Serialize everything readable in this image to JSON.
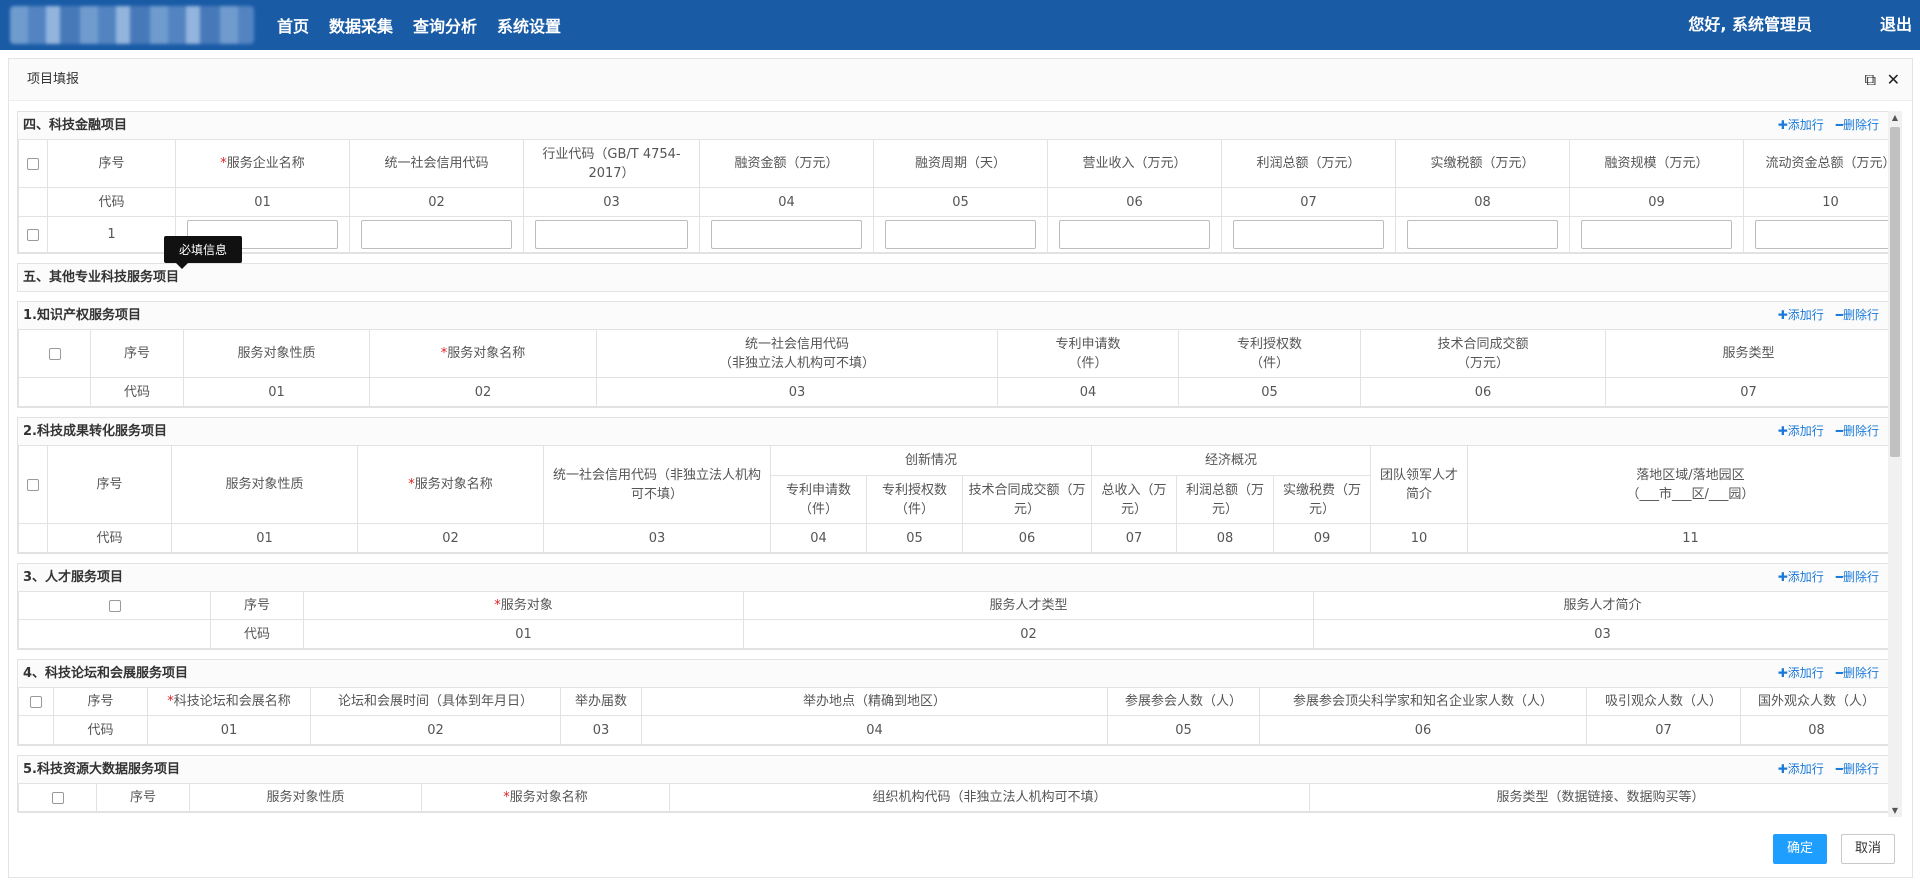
{
  "nav": {
    "items": [
      "首页",
      "数据采集",
      "查询分析",
      "系统设置"
    ],
    "greeting": "您好, 系统管理员",
    "logout": "退出"
  },
  "dialog": {
    "title": "项目填报",
    "confirm": "确定",
    "cancel": "取消",
    "tooltip": "必填信息"
  },
  "ops": {
    "add": "✚添加行",
    "del": "━删除行"
  },
  "s4": {
    "title": "四、科技金融项目",
    "headers": [
      "序号",
      "服务企业名称",
      "统一社会信用代码",
      "行业代码（GB/T 4754-2017）",
      "融资金额（万元）",
      "融资周期（天）",
      "营业收入（万元）",
      "利润总额（万元）",
      "实缴税额（万元）",
      "融资规模（万元）",
      "流动资金总额（万元）"
    ],
    "codes": [
      "代码",
      "01",
      "02",
      "03",
      "04",
      "05",
      "06",
      "07",
      "08",
      "09",
      "10"
    ],
    "row_no": "1"
  },
  "s5": {
    "title": "五、其他专业科技服务项目"
  },
  "s51": {
    "title": "1.知识产权服务项目",
    "headers": [
      "序号",
      "服务对象性质",
      "服务对象名称",
      "统一社会信用代码\n（非独立法人机构可不填）",
      "专利申请数\n（件）",
      "专利授权数\n（件）",
      "技术合同成交额\n（万元）",
      "服务类型"
    ],
    "codes": [
      "代码",
      "01",
      "02",
      "03",
      "04",
      "05",
      "06",
      "07"
    ]
  },
  "s52": {
    "title": "2.科技成果转化服务项目",
    "headers": [
      "序号",
      "服务对象性质",
      "服务对象名称",
      "统一社会信用代码（非独立法人机构可不填）",
      "团队领军人才简介",
      "落地区域/落地园区\n（___市___区/___园）"
    ],
    "group1": "创新情况",
    "group2": "经济概况",
    "sub": [
      "专利申请数（件）",
      "专利授权数（件）",
      "技术合同成交额（万元）",
      "总收入（万元）",
      "利润总额（万元）",
      "实缴税费（万元）"
    ],
    "codes": [
      "代码",
      "01",
      "02",
      "03",
      "04",
      "05",
      "06",
      "07",
      "08",
      "09",
      "10",
      "11"
    ]
  },
  "s3": {
    "title": "3、人才服务项目",
    "headers": [
      "序号",
      "服务对象",
      "服务人才类型",
      "服务人才简介"
    ],
    "codes": [
      "代码",
      "01",
      "02",
      "03"
    ]
  },
  "s4b": {
    "title": "4、科技论坛和会展服务项目",
    "headers": [
      "序号",
      "科技论坛和会展名称",
      "论坛和会展时间（具体到年月日）",
      "举办届数",
      "举办地点（精确到地区）",
      "参展参会人数（人）",
      "参展参会顶尖科学家和知名企业家人数（人）",
      "吸引观众人数（人）",
      "国外观众人数（人）"
    ],
    "codes": [
      "代码",
      "01",
      "02",
      "03",
      "04",
      "05",
      "06",
      "07",
      "08"
    ]
  },
  "s5b": {
    "title": "5.科技资源大数据服务项目",
    "headers": [
      "序号",
      "服务对象性质",
      "服务对象名称",
      "组织机构代码（非独立法人机构可不填）",
      "服务类型（数据链接、数据购买等）"
    ]
  }
}
